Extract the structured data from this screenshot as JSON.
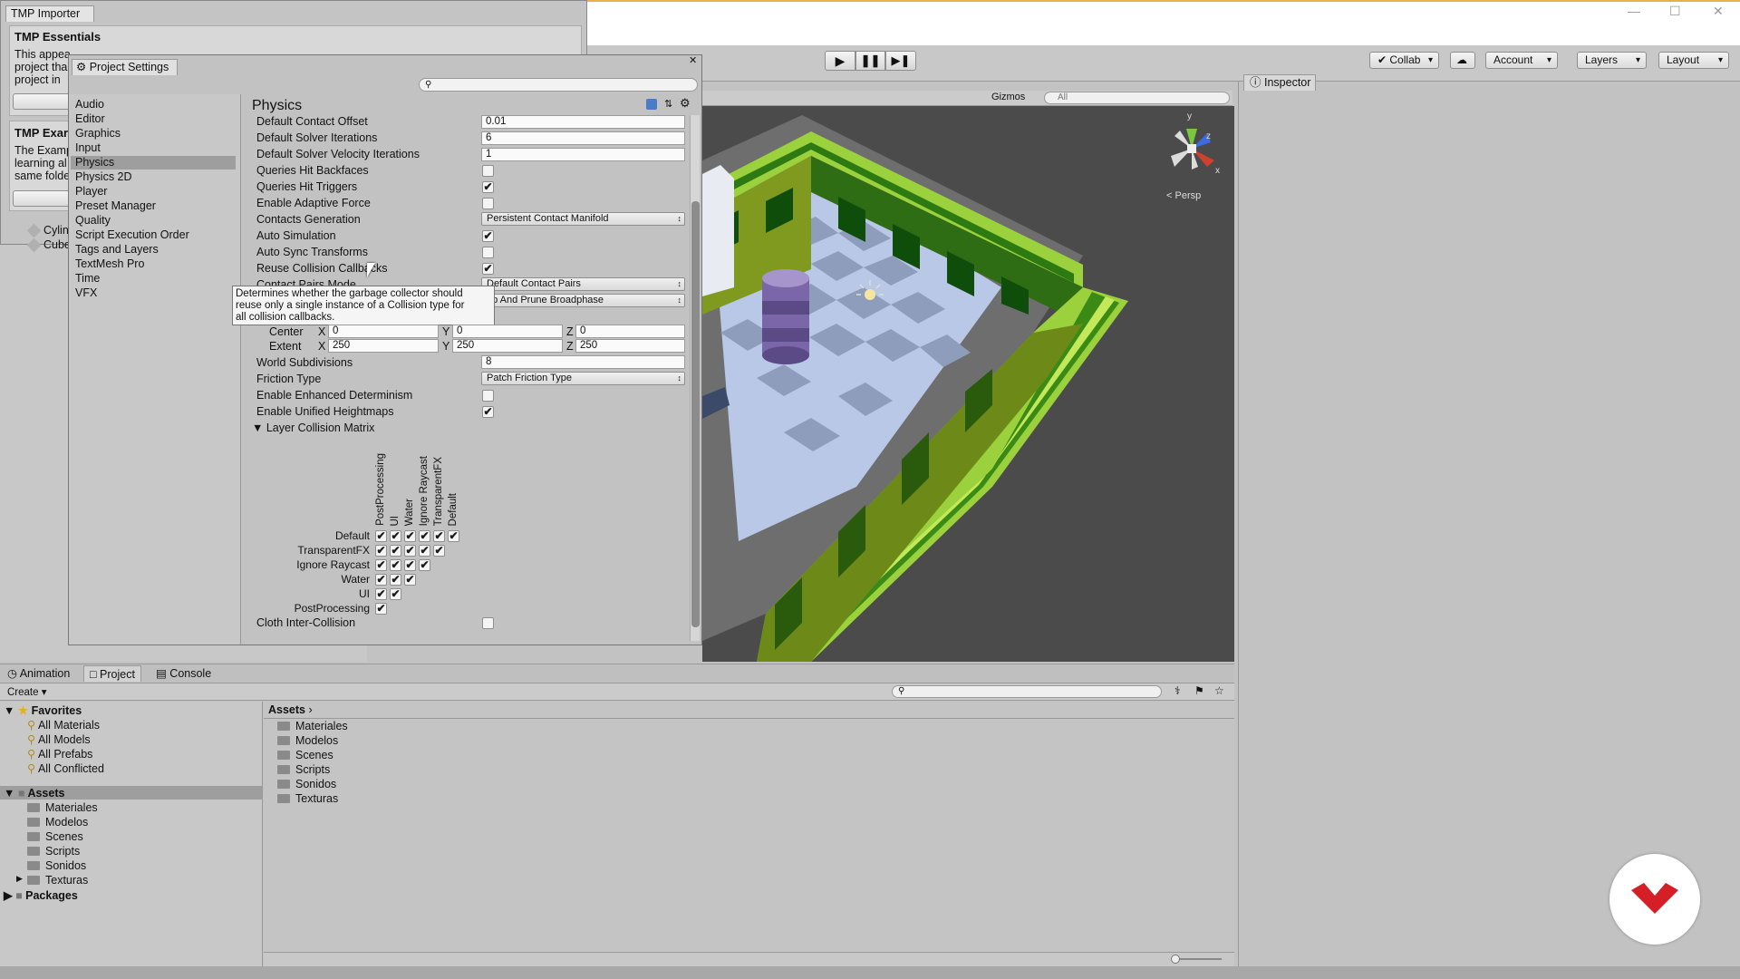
{
  "window": {
    "controls": [
      "—",
      "☐",
      "✕"
    ]
  },
  "toolbar": {
    "collab": "Collab",
    "account": "Account",
    "layers": "Layers",
    "layout": "Layout"
  },
  "tmp": {
    "tab": "TMP Importer",
    "essentials_title": "TMP Essentials",
    "essentials_text": [
      "This appea",
      "project tha",
      "project in"
    ],
    "examples_title": "TMP Exar",
    "examples_text": [
      "The Examp",
      "learning al",
      "same folde"
    ],
    "hierarchy": [
      "Cylin",
      "Cube"
    ]
  },
  "settings": {
    "tab": "Project Settings",
    "search_placeholder": "",
    "categories": [
      "Audio",
      "Editor",
      "Graphics",
      "Input",
      "Physics",
      "Physics 2D",
      "Player",
      "Preset Manager",
      "Quality",
      "Script Execution Order",
      "Tags and Layers",
      "TextMesh Pro",
      "Time",
      "VFX"
    ],
    "section_title": "Physics",
    "labels": {
      "contact_offset": "Default Contact Offset",
      "solver_iter": "Default Solver Iterations",
      "solver_vel": "Default Solver Velocity Iterations",
      "hit_backfaces": "Queries Hit Backfaces",
      "hit_triggers": "Queries Hit Triggers",
      "adaptive_force": "Enable Adaptive Force",
      "contacts_gen": "Contacts Generation",
      "auto_sim": "Auto Simulation",
      "auto_sync": "Auto Sync Transforms",
      "reuse_cb": "Reuse Collision Callbacks",
      "pairs_mode": "Contact Pairs Mode",
      "center": "Center",
      "extent": "Extent",
      "world_subdiv": "World Subdivisions",
      "friction": "Friction Type",
      "determinism": "Enable Enhanced Determinism",
      "heightmaps": "Enable Unified Heightmaps",
      "matrix": "Layer Collision Matrix",
      "cloth": "Cloth Inter-Collision"
    },
    "values": {
      "contact_offset": "0.01",
      "solver_iter": "6",
      "solver_vel": "1",
      "contacts_gen": "Persistent Contact Manifold",
      "pairs_mode": "Default Contact Pairs",
      "broadphase": "ep And Prune Broadphase",
      "center_x": "0",
      "center_y": "0",
      "center_z": "0",
      "extent_x": "250",
      "extent_y": "250",
      "extent_z": "250",
      "world_subdiv": "8",
      "friction": "Patch Friction Type"
    },
    "axis": {
      "x": "X",
      "y": "Y",
      "z": "Z"
    },
    "tooltip": [
      "Determines whether the garbage collector should",
      "reuse only a single instance of a Collision type for",
      "all collision callbacks."
    ],
    "matrix_cols": [
      "PostProcessing",
      "UI",
      "Water",
      "Ignore Raycast",
      "TransparentFX",
      "Default"
    ],
    "matrix_rows": [
      "Default",
      "TransparentFX",
      "Ignore Raycast",
      "Water",
      "UI",
      "PostProcessing"
    ]
  },
  "scene": {
    "gizmos": "Gizmos",
    "search": "All",
    "persp": "Persp",
    "axis_y": "y",
    "axis_x": "x",
    "axis_z": "z"
  },
  "inspector": {
    "tab": "Inspector"
  },
  "bottom": {
    "tabs": [
      "Animation",
      "Project",
      "Console"
    ],
    "create": "Create",
    "favorites_title": "Favorites",
    "favorites": [
      "All Materials",
      "All Models",
      "All Prefabs",
      "All Conflicted"
    ],
    "assets_title": "Assets",
    "asset_folders": [
      "Materiales",
      "Modelos",
      "Scenes",
      "Scripts",
      "Sonidos",
      "Texturas"
    ],
    "packages": "Packages",
    "breadcrumb": "Assets",
    "main_folders": [
      "Materiales",
      "Modelos",
      "Scenes",
      "Scripts",
      "Sonidos",
      "Texturas"
    ]
  }
}
